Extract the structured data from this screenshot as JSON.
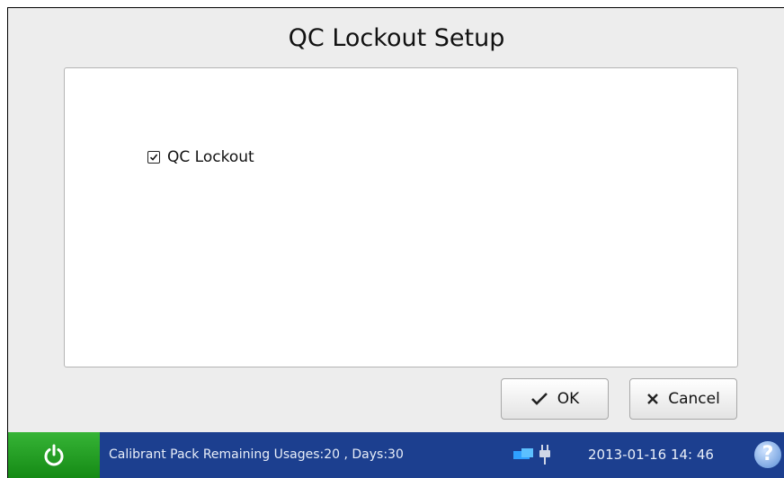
{
  "dialog": {
    "title": "QC Lockout Setup",
    "option_label": "QC Lockout",
    "option_checked": true
  },
  "buttons": {
    "ok_label": "OK",
    "cancel_label": "Cancel"
  },
  "taskbar": {
    "status": "Calibrant Pack Remaining Usages:20 , Days:30",
    "datetime": "2013-01-16  14: 46",
    "help_symbol": "?"
  },
  "icons": [
    "power-icon",
    "network-icon",
    "plug-icon",
    "help-icon",
    "checkmark-icon",
    "x-icon"
  ],
  "colors": {
    "taskbar": "#1c3f8f",
    "power": "#2aa62a"
  }
}
